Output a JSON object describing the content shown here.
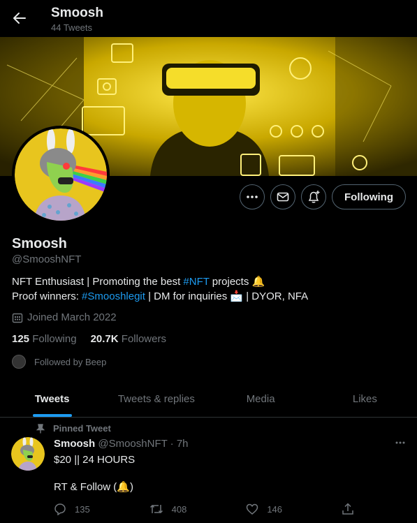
{
  "header": {
    "name": "Smoosh",
    "tweet_count": "44 Tweets"
  },
  "profile": {
    "name": "Smoosh",
    "handle": "@SmooshNFT",
    "bio_line1_a": "NFT Enthusiast | Promoting the best ",
    "bio_line1_tag": "#NFT",
    "bio_line1_b": " projects ",
    "bio_line2_a": "Proof winners: ",
    "bio_line2_tag": "#Smooshlegit",
    "bio_line2_b": " | DM for inquiries ",
    "bio_line2_c": " | DYOR, NFA",
    "joined": "Joined March 2022",
    "following_count": "125",
    "following_label": "Following",
    "followers_count": "20.7K",
    "followers_label": "Followers",
    "followed_by": "Followed by Beep",
    "follow_button": "Following"
  },
  "tabs": [
    {
      "label": "Tweets",
      "active": true
    },
    {
      "label": "Tweets & replies",
      "active": false
    },
    {
      "label": "Media",
      "active": false
    },
    {
      "label": "Likes",
      "active": false
    }
  ],
  "pinned_tweet": {
    "pinned_label": "Pinned Tweet",
    "author": "Smoosh",
    "meta": "@SmooshNFT · 7h",
    "line1": "$20 || 24 HOURS",
    "line2_a": "RT & Follow (",
    "line2_b": ")",
    "replies": "135",
    "retweets": "408",
    "likes": "146"
  },
  "colors": {
    "background": "#000000",
    "accent": "#1d9bf0",
    "muted": "#71767b",
    "banner": "#f0d000"
  }
}
